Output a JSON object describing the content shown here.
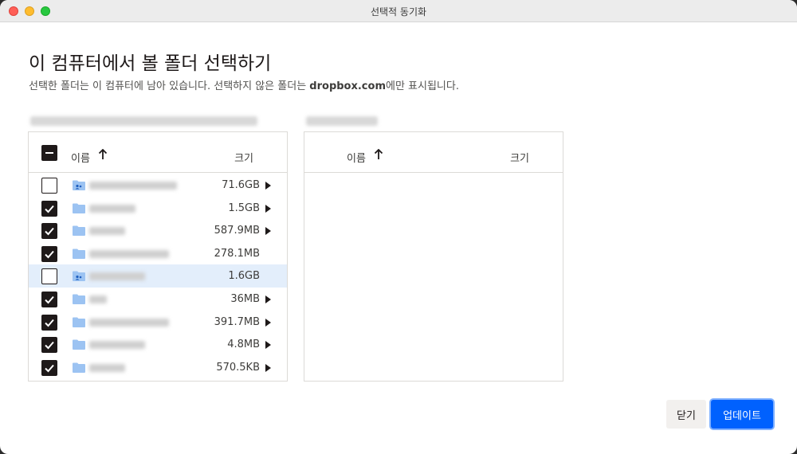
{
  "window": {
    "title": "선택적 동기화"
  },
  "header": {
    "heading": "이 컴퓨터에서 볼 폴더 선택하기",
    "sub_pre": "선택한 폴더는 이 컴퓨터에 남아 있습니다. 선택하지 않은 폴더는 ",
    "sub_bold": "dropbox.com",
    "sub_post": "에만 표시됩니다."
  },
  "left_panel": {
    "col_name": "이름",
    "col_size": "크기",
    "rows": [
      {
        "size": "71.6GB",
        "checked": false,
        "shared": true,
        "expandable": true,
        "selected": false
      },
      {
        "size": "1.5GB",
        "checked": true,
        "shared": false,
        "expandable": true,
        "selected": false
      },
      {
        "size": "587.9MB",
        "checked": true,
        "shared": false,
        "expandable": true,
        "selected": false
      },
      {
        "size": "278.1MB",
        "checked": true,
        "shared": false,
        "expandable": false,
        "selected": false
      },
      {
        "size": "1.6GB",
        "checked": false,
        "shared": true,
        "expandable": false,
        "selected": true
      },
      {
        "size": "36MB",
        "checked": true,
        "shared": false,
        "expandable": true,
        "selected": false
      },
      {
        "size": "391.7MB",
        "checked": true,
        "shared": false,
        "expandable": true,
        "selected": false
      },
      {
        "size": "4.8MB",
        "checked": true,
        "shared": false,
        "expandable": true,
        "selected": false
      },
      {
        "size": "570.5KB",
        "checked": true,
        "shared": false,
        "expandable": true,
        "selected": false
      }
    ]
  },
  "right_panel": {
    "col_name": "이름",
    "col_size": "크기"
  },
  "footer": {
    "close_label": "닫기",
    "update_label": "업데이트"
  },
  "colors": {
    "accent": "#0061fe",
    "selected_row": "#e3eefb",
    "folder": "#9cc3f2"
  }
}
